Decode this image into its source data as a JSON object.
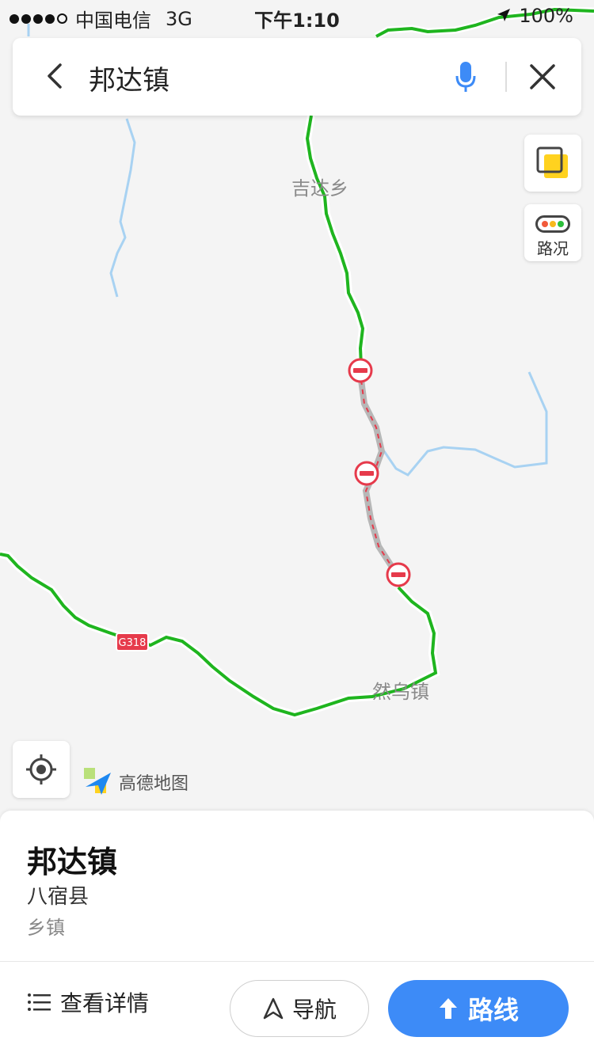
{
  "status_bar": {
    "carrier": "中国电信",
    "network": "3G",
    "time": "下午1:10",
    "battery": "100%"
  },
  "search": {
    "query": "邦达镇"
  },
  "map": {
    "labels": {
      "jida": "吉达乡",
      "ranwu": "然乌镇",
      "road": "G318"
    },
    "traffic_label": "路况",
    "brand": "高德地图",
    "colors": {
      "road_green": "#1fb51f",
      "closed_red": "#e63a4b",
      "river_blue": "#a8d2f2",
      "accent_blue": "#3d8bf7"
    }
  },
  "place": {
    "name": "邦达镇",
    "county": "八宿县",
    "type": "乡镇"
  },
  "actions": {
    "details": "查看详情",
    "navigate": "导航",
    "route": "路线"
  }
}
